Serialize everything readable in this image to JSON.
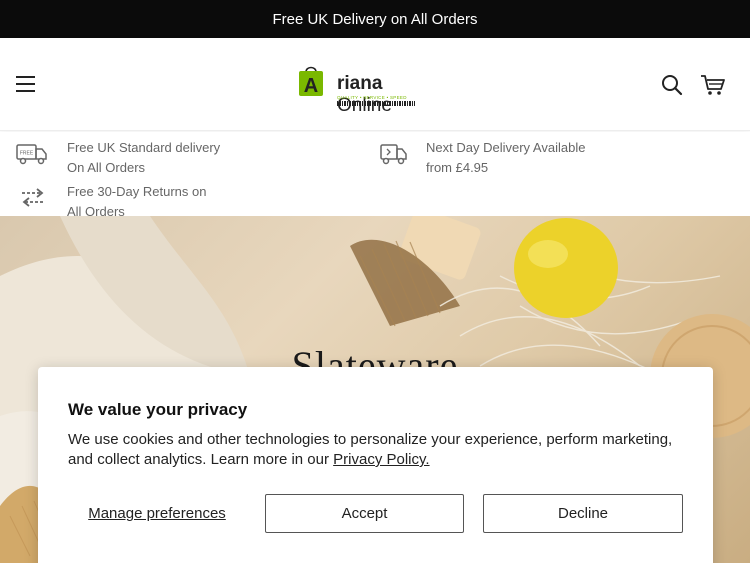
{
  "announcement": "Free UK Delivery on All Orders",
  "header": {
    "logo": {
      "prefix": "A",
      "brand": "riana",
      "suffix": " Online",
      "tagline": "QUALITY • SERVICE • SPEED"
    }
  },
  "features": [
    {
      "icon": "delivery-truck-icon",
      "line1": "Free UK Standard delivery",
      "line2": "On All Orders"
    },
    {
      "icon": "fast-truck-icon",
      "line1": "Next Day Delivery Available",
      "line2": "from £4.95"
    },
    {
      "icon": "returns-arrows-icon",
      "line1": "Free 30-Day Returns on",
      "line2": "All Orders"
    }
  ],
  "hero": {
    "title": "Slateware"
  },
  "cookie": {
    "title": "We value your privacy",
    "text": "We use cookies and other technologies to personalize your experience, perform marketing, and collect analytics. Learn more in our ",
    "link": "Privacy Policy.",
    "manage": "Manage preferences",
    "accept": "Accept",
    "decline": "Decline"
  },
  "colors": {
    "announcement_bg": "#0b0b0b",
    "logo_green": "#7ab800"
  }
}
